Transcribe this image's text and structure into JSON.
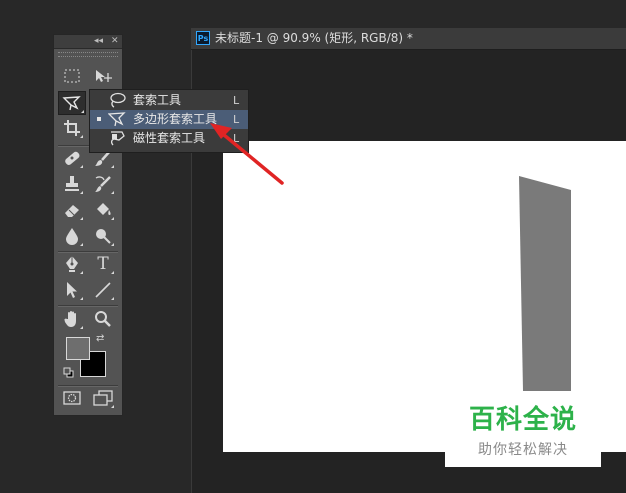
{
  "document": {
    "ps_badge": "Ps",
    "title": "未标题-1 @ 90.9% (矩形, RGB/8) *"
  },
  "tools_panel": {
    "collapse_glyph": "◂◂",
    "close_glyph": "✕",
    "tools": [
      {
        "name": "rectangular-marquee-tool",
        "icon": "marquee-icon"
      },
      {
        "name": "move-tool",
        "icon": "move-icon"
      },
      {
        "name": "polygonal-lasso-tool",
        "icon": "polygonal-lasso-icon",
        "active": true
      },
      {
        "name": "crop-tool",
        "icon": "crop-icon"
      },
      {
        "name": "healing-brush-tool",
        "icon": "bandage-icon"
      },
      {
        "name": "brush-tool",
        "icon": "brush-icon"
      },
      {
        "name": "clone-stamp-tool",
        "icon": "stamp-icon"
      },
      {
        "name": "history-brush-tool",
        "icon": "history-brush-icon"
      },
      {
        "name": "eraser-tool",
        "icon": "eraser-icon"
      },
      {
        "name": "paint-bucket-tool",
        "icon": "bucket-icon"
      },
      {
        "name": "blur-tool",
        "icon": "drop-icon"
      },
      {
        "name": "dodge-tool",
        "icon": "dodge-icon"
      },
      {
        "name": "pen-tool",
        "icon": "pen-icon"
      },
      {
        "name": "type-tool",
        "icon": "type-icon",
        "label": "T"
      },
      {
        "name": "path-selection-tool",
        "icon": "arrow-cursor-icon"
      },
      {
        "name": "line-tool",
        "icon": "line-icon"
      },
      {
        "name": "hand-tool",
        "icon": "hand-icon"
      },
      {
        "name": "zoom-tool",
        "icon": "zoom-icon"
      },
      {
        "name": "quick-mask-button",
        "icon": "quick-mask-icon"
      },
      {
        "name": "screen-mode-button",
        "icon": "screen-mode-icon"
      }
    ],
    "foreground_color": "#6e6e6e",
    "background_color": "#000000",
    "swap_glyph": "⇄"
  },
  "flyout": {
    "items": [
      {
        "label": "套索工具",
        "shortcut": "L",
        "icon": "lasso-icon",
        "selected": false
      },
      {
        "label": "多边形套索工具",
        "shortcut": "L",
        "icon": "polygonal-lasso-icon",
        "selected": true
      },
      {
        "label": "磁性套索工具",
        "shortcut": "L",
        "icon": "magnetic-lasso-icon",
        "selected": false
      }
    ]
  },
  "canvas": {
    "background": "#ffffff",
    "shape_color": "#7a7a7a"
  },
  "watermark": {
    "title": "百科全说",
    "subtitle": "助你轻松解决"
  },
  "annotation": {
    "arrow_color": "#e02424"
  }
}
